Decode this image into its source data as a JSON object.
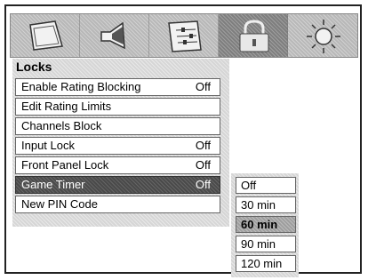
{
  "tabs": [
    {
      "icon": "picture-icon"
    },
    {
      "icon": "speaker-icon"
    },
    {
      "icon": "setup-icon"
    },
    {
      "icon": "lock-icon",
      "active": true
    },
    {
      "icon": "sun-icon"
    }
  ],
  "menu": {
    "title": "Locks",
    "items": [
      {
        "label": "Enable Rating Blocking",
        "value": "Off"
      },
      {
        "label": "Edit Rating Limits",
        "value": ""
      },
      {
        "label": "Channels Block",
        "value": ""
      },
      {
        "label": "Input Lock",
        "value": "Off"
      },
      {
        "label": "Front Panel Lock",
        "value": "Off"
      },
      {
        "label": "Game Timer",
        "value": "Off",
        "selected": true
      },
      {
        "label": "New PIN Code",
        "value": ""
      }
    ]
  },
  "dropdown": {
    "options": [
      "Off",
      "30 min",
      "60 min",
      "90 min",
      "120 min"
    ],
    "selected": "60 min"
  },
  "colors": {
    "selected_row": "#4a4a4a",
    "tab_bar": "#b8b8b8",
    "active_tab": "#7e7e7e"
  }
}
